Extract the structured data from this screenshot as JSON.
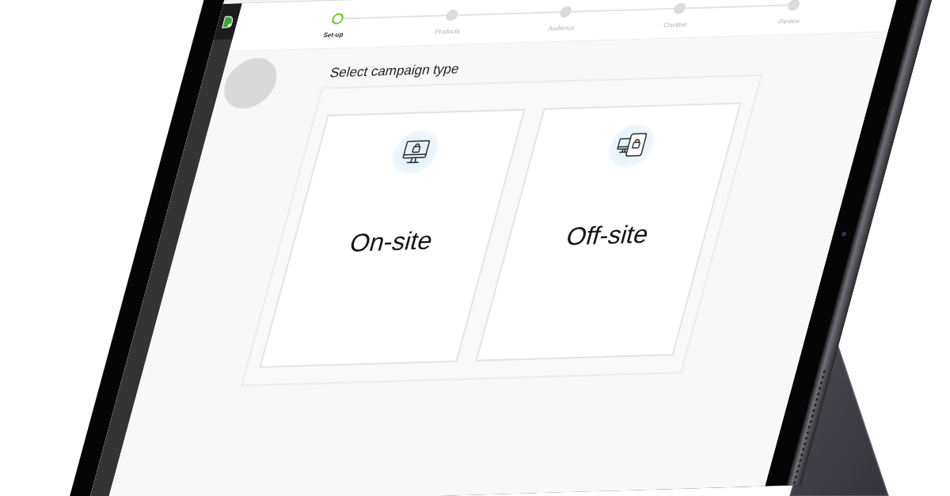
{
  "stepper": {
    "steps": [
      {
        "label": "Set-up",
        "selected": true
      },
      {
        "label": "Products",
        "selected": false
      },
      {
        "label": "Audience",
        "selected": false
      },
      {
        "label": "Creative",
        "selected": false
      },
      {
        "label": "Review",
        "selected": false
      }
    ]
  },
  "campaign_type": {
    "title": "Select campaign type",
    "options": [
      {
        "label": "On-site",
        "kind": "desktop",
        "selected": false
      },
      {
        "label": "Off-site",
        "kind": "multi-device",
        "selected": false
      }
    ]
  }
}
